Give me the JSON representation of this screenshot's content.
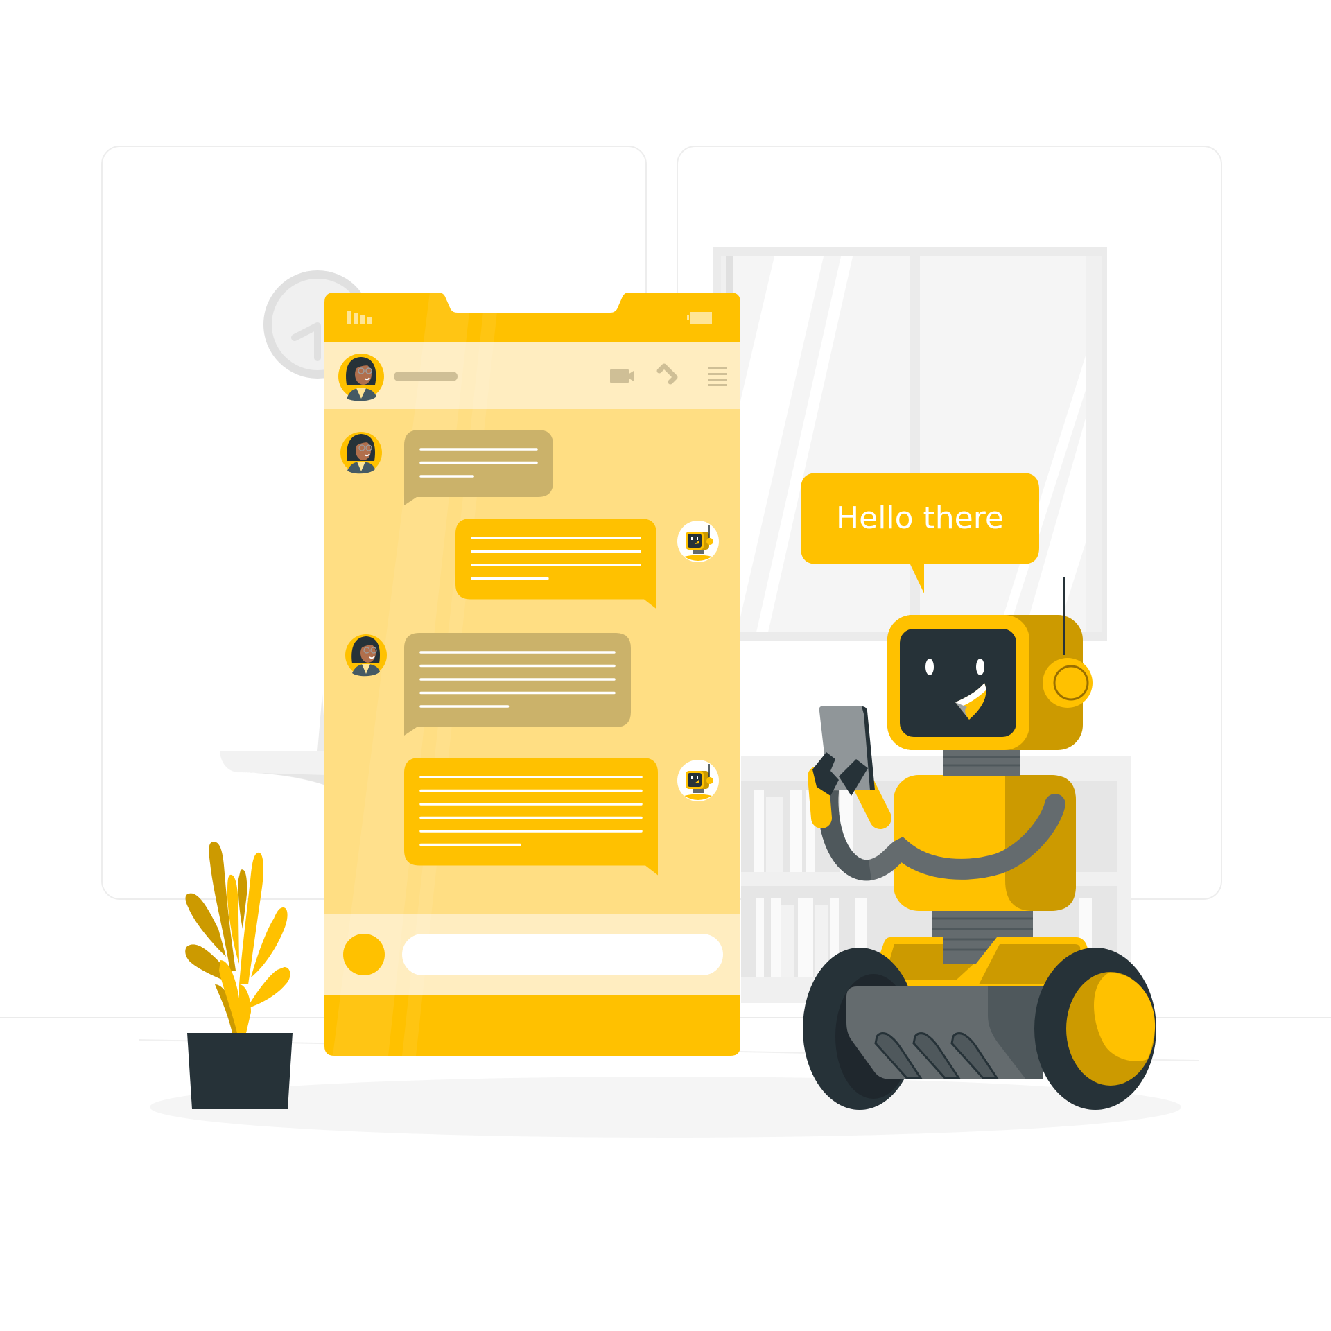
{
  "scene": {
    "title": "Chatbot conversation illustration",
    "colors": {
      "background": "#ffffff",
      "panel_border": "#ebebeb",
      "wall_gray": "#f5f5f5",
      "frame_gray": "#ebebeb",
      "yellow": "#ffc100",
      "yellow_dark": "#cc9a00",
      "yellow_light": "#ffde83",
      "yellow_pale": "#ffedc0",
      "bubble_user": "#cbb26a",
      "icon_tan": "#cfbf96",
      "charcoal": "#263238",
      "gray_mid": "#646b6e",
      "gray_dark": "#4f585c",
      "skin": "#b16f4c"
    }
  },
  "phone": {
    "status_bar": {
      "signal_icon": "signal-bars-icon",
      "battery_icon": "battery-icon"
    },
    "header": {
      "contact_avatar": "woman-avatar",
      "contact_name_placeholder": "",
      "actions": [
        {
          "name": "video-call",
          "icon": "video-camera-icon"
        },
        {
          "name": "voice-call",
          "icon": "phone-icon"
        },
        {
          "name": "menu",
          "icon": "hamburger-menu-icon"
        }
      ]
    },
    "messages": [
      {
        "sender": "user",
        "avatar": "woman-avatar",
        "line_count": 3
      },
      {
        "sender": "bot",
        "avatar": "robot-avatar",
        "line_count": 4
      },
      {
        "sender": "user",
        "avatar": "woman-avatar",
        "line_count": 5
      },
      {
        "sender": "bot",
        "avatar": "robot-avatar",
        "line_count": 6
      }
    ],
    "composer": {
      "attach_button_icon": "circle-button",
      "input_placeholder": "",
      "input_value": ""
    }
  },
  "robot": {
    "speech_bubble": {
      "text": "Hello there"
    },
    "holding": "smartphone"
  },
  "decor": {
    "plant": "potted-plant",
    "clock": "wall-clock",
    "window": "window",
    "bookshelf": "bookshelf",
    "desk": "desk-shelf"
  }
}
